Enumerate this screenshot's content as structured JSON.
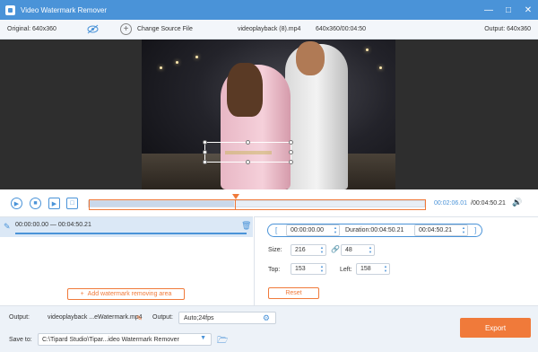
{
  "window": {
    "title": "Video Watermark Remover"
  },
  "info": {
    "original": "Original: 640x360",
    "change_source": "Change Source File",
    "filename": "videoplayback (8).mp4",
    "dims_time": "640x360/00:04:50",
    "output": "Output: 640x360"
  },
  "playback": {
    "current_time": "00:02:06.01",
    "total_time": "/00:04:50.21"
  },
  "segment": {
    "range": "00:00:00.00 — 00:04:50.21",
    "add_label": "Add watermark removing area"
  },
  "area": {
    "start": "00:00:00.00",
    "duration": "Duration:00:04:50.21",
    "end": "00:04:50.21",
    "size_label": "Size:",
    "width": "216",
    "height": "48",
    "top_label": "Top:",
    "top": "153",
    "left_label": "Left:",
    "left": "158",
    "reset_label": "Reset"
  },
  "bottom": {
    "output_label": "Output:",
    "output_file": "videoplayback ...eWatermark.mp4",
    "format_label": "Output:",
    "format_value": "Auto;24fps",
    "save_label": "Save to:",
    "save_path": "C:\\Tipard Studio\\Tipar...ideo Watermark Remover",
    "export_label": "Export"
  },
  "colors": {
    "accent": "#4a93d8",
    "orange": "#f07a3a"
  }
}
